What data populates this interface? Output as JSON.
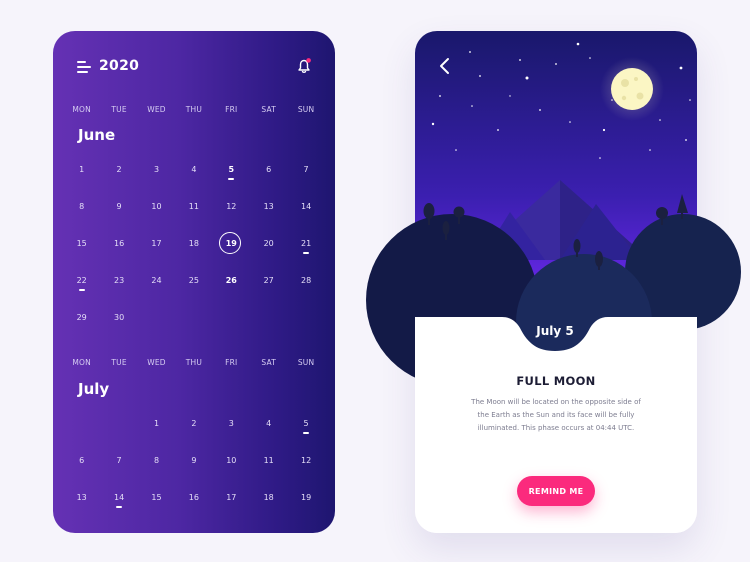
{
  "calendar": {
    "year": "2020",
    "weekdays": [
      "MON",
      "TUE",
      "WED",
      "THU",
      "FRI",
      "SAT",
      "SUN"
    ],
    "june": {
      "title": "June",
      "days": [
        "1",
        "2",
        "3",
        "4",
        "5",
        "6",
        "7",
        "8",
        "9",
        "10",
        "11",
        "12",
        "13",
        "14",
        "15",
        "16",
        "17",
        "18",
        "19",
        "20",
        "21",
        "22",
        "23",
        "24",
        "25",
        "26",
        "27",
        "28",
        "29",
        "30"
      ]
    },
    "july": {
      "title": "July",
      "days": [
        "1",
        "2",
        "3",
        "4",
        "5",
        "6",
        "7",
        "8",
        "9",
        "10",
        "11",
        "12",
        "13",
        "14",
        "15",
        "16",
        "17",
        "18",
        "19"
      ]
    }
  },
  "event": {
    "date": "July 5",
    "title": "FULL MOON",
    "description": "The Moon will be located on the opposite side of the Earth as the Sun and its face will be fully illuminated. This phase occurs at 04:44 UTC.",
    "button_label": "REMIND ME"
  },
  "colors": {
    "calendar_gradient_start": "#6531b4",
    "calendar_gradient_end": "#1e1670",
    "accent_pink": "#fb2a7d",
    "sky_top": "#19186b",
    "sky_bottom": "#7a2cff",
    "hill_dark": "#141a4a"
  }
}
